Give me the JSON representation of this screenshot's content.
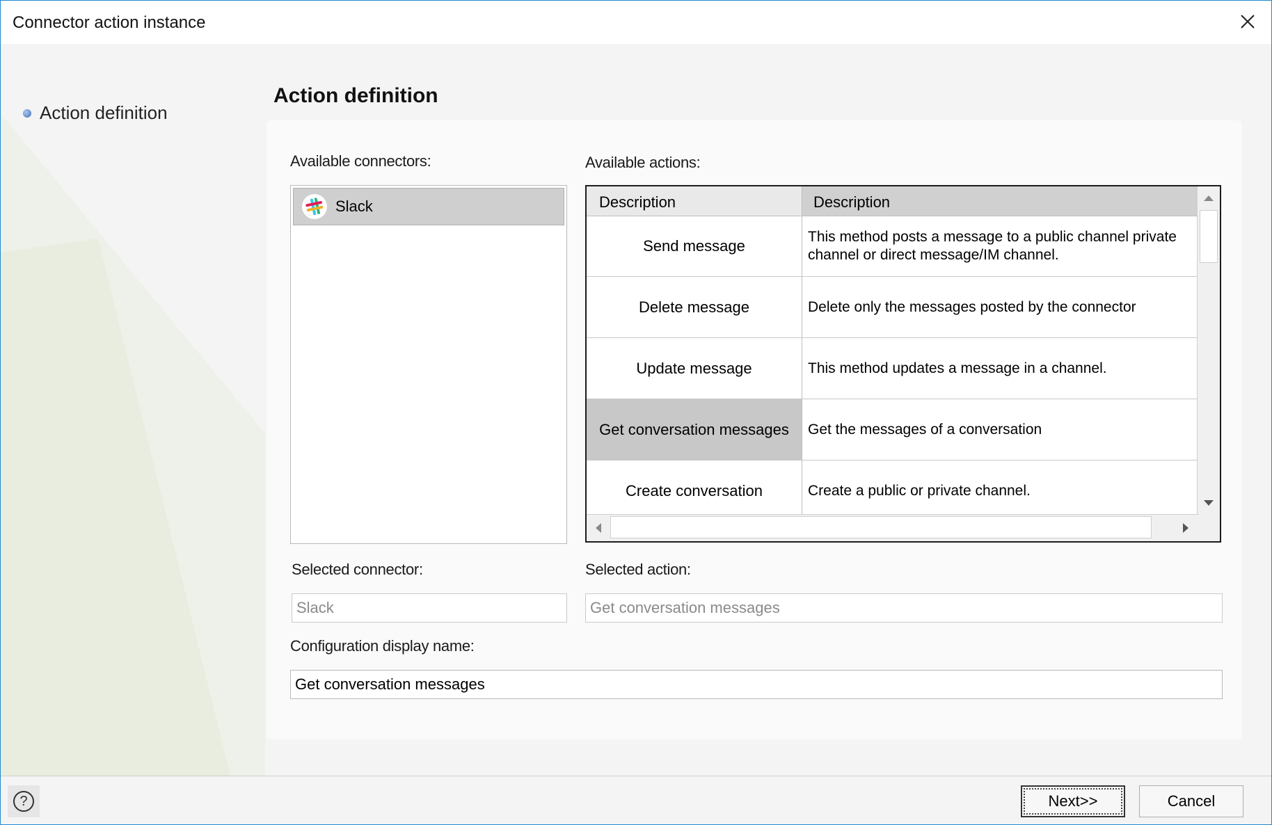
{
  "window": {
    "title": "Connector action instance"
  },
  "nav": {
    "items": [
      {
        "label": "Action definition"
      }
    ]
  },
  "page": {
    "title": "Action definition"
  },
  "connectors": {
    "label": "Available connectors:",
    "items": [
      {
        "name": "Slack",
        "icon": "slack-logo-icon"
      }
    ]
  },
  "actions": {
    "label": "Available actions:",
    "columns": [
      "Description",
      "Description"
    ],
    "rows": [
      {
        "name": "Send message",
        "description": "This method posts a message to a public channel private\nchannel or direct message/IM channel."
      },
      {
        "name": "Delete message",
        "description": "Delete only the messages posted by the connector"
      },
      {
        "name": "Update message",
        "description": "This method updates a message in a channel."
      },
      {
        "name": "Get conversation messages",
        "description": "Get the messages of a conversation"
      },
      {
        "name": "Create conversation",
        "description": "Create a public or private channel."
      }
    ],
    "selected_row": 3
  },
  "selected_connector": {
    "label": "Selected connector:",
    "value": "Slack"
  },
  "selected_action": {
    "label": "Selected action:",
    "value": "Get conversation messages"
  },
  "config_name": {
    "label": "Configuration display name:",
    "value": "Get conversation messages"
  },
  "footer": {
    "help": "?",
    "next": "Next>>",
    "cancel": "Cancel"
  },
  "colors": {
    "window_border": "#1e88d0",
    "selection": "#c8c8c8",
    "accent_bullet": "#3f6fb8"
  }
}
